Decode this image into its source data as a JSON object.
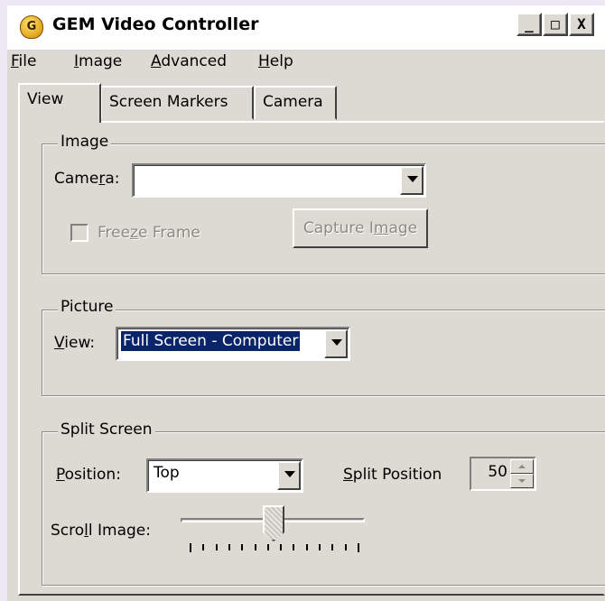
{
  "window": {
    "title": "GEM Video Controller",
    "icon_letter": "G",
    "controls": {
      "minimize": "_",
      "maximize": "□",
      "close": "X"
    }
  },
  "menu": [
    "File",
    "Image",
    "Advanced",
    "Help"
  ],
  "tabs": [
    {
      "label": "View",
      "selected": true
    },
    {
      "label": "Screen Markers",
      "selected": false
    },
    {
      "label": "Camera",
      "selected": false
    }
  ],
  "image_group": {
    "title": "Image",
    "camera_label": "Camera:",
    "camera_value": "",
    "freeze_frame_label": "Freeze Frame",
    "freeze_frame_checked": false,
    "capture_button": "Capture Image"
  },
  "picture_group": {
    "title": "Picture",
    "view_label": "View:",
    "view_value": "Full Screen - Computer"
  },
  "split_group": {
    "title": "Split Screen",
    "position_label": "Position:",
    "position_value": "Top",
    "split_position_label": "Split Position",
    "split_position_value": "50",
    "scroll_image_label": "Scroll Image:",
    "scroll_image_level": 0.5
  },
  "colors": {
    "dialog_bg": "#dcdad3",
    "selection_bg": "#0a246a",
    "disabled_text": "#8c8a84"
  }
}
